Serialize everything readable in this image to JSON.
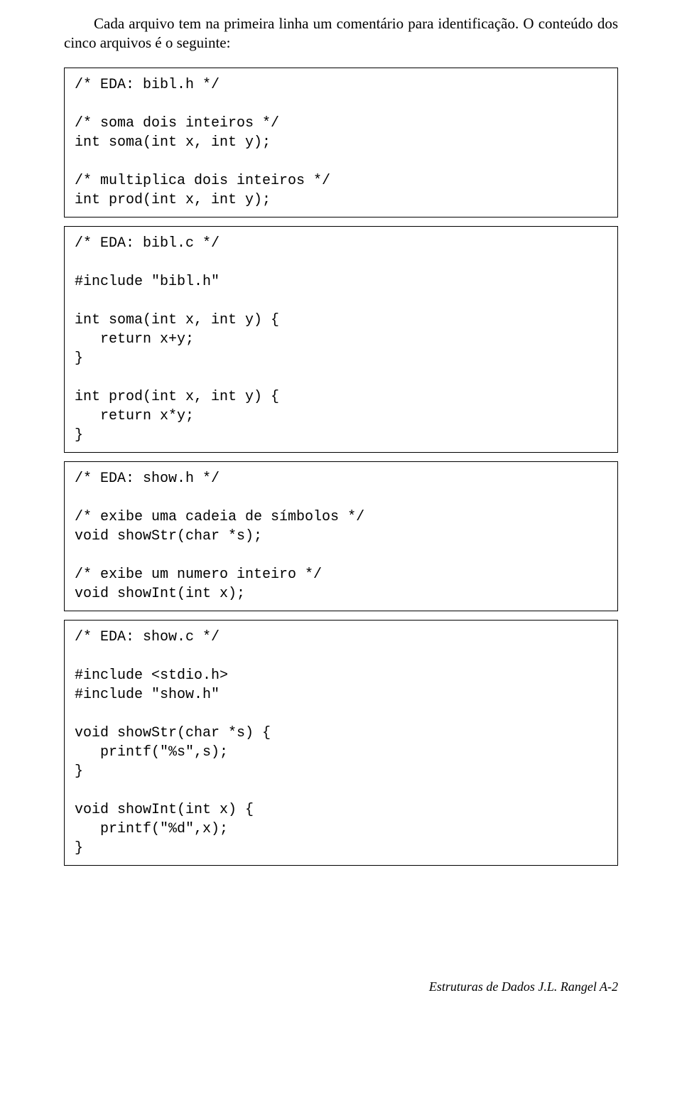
{
  "intro": "Cada arquivo tem na primeira linha um comentário para identificação. O conteúdo dos cinco arquivos é o seguinte:",
  "blocks": [
    "/* EDA: bibl.h */\n\n/* soma dois inteiros */\nint soma(int x, int y);\n\n/* multiplica dois inteiros */\nint prod(int x, int y);",
    "/* EDA: bibl.c */\n\n#include \"bibl.h\"\n\nint soma(int x, int y) {\n   return x+y;\n}\n\nint prod(int x, int y) {\n   return x*y;\n}",
    "/* EDA: show.h */\n\n/* exibe uma cadeia de símbolos */\nvoid showStr(char *s);\n\n/* exibe um numero inteiro */\nvoid showInt(int x);",
    "/* EDA: show.c */\n\n#include <stdio.h>\n#include \"show.h\"\n\nvoid showStr(char *s) {\n   printf(\"%s\",s);\n}\n\nvoid showInt(int x) {\n   printf(\"%d\",x);\n}"
  ],
  "footer": "Estruturas de Dados J.L. Rangel A-2"
}
